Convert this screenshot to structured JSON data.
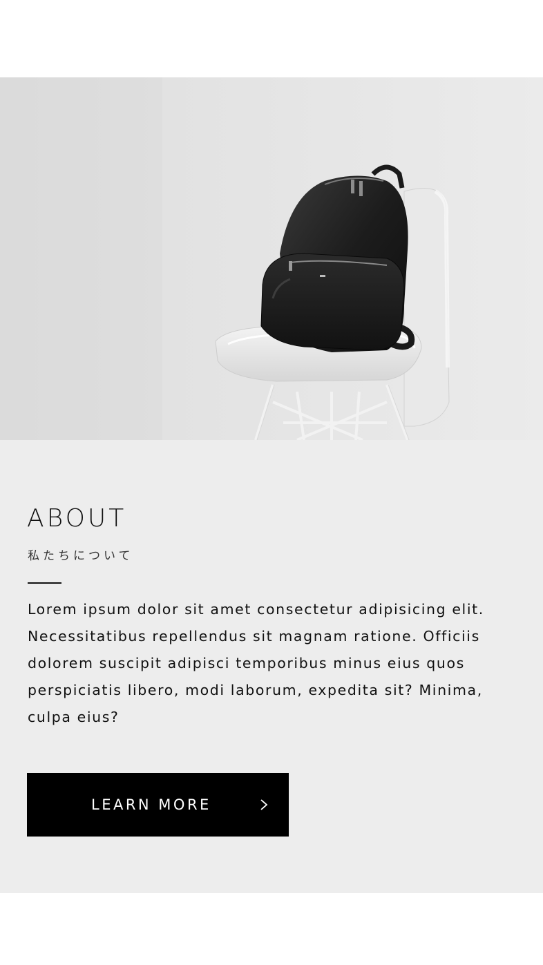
{
  "hero": {
    "image_subject": "black backpack on white chair",
    "icon": "backpack-photo"
  },
  "about": {
    "title": "ABOUT",
    "subtitle": "私たちについて",
    "body": "Lorem ipsum dolor sit amet consectetur adipisicing elit. Necessitatibus repellendus sit magnam ratione. Officiis dolorem suscipit adipisci temporibus minus eius quos perspiciatis libero, modi laborum, expedita sit? Minima, culpa eius?",
    "button_label": "LEARN MORE",
    "button_icon": "chevron-right-icon"
  },
  "colors": {
    "page_bg": "#ffffff",
    "section_bg": "#ededed",
    "text": "#111111",
    "button_bg": "#000000",
    "button_text": "#ffffff"
  }
}
